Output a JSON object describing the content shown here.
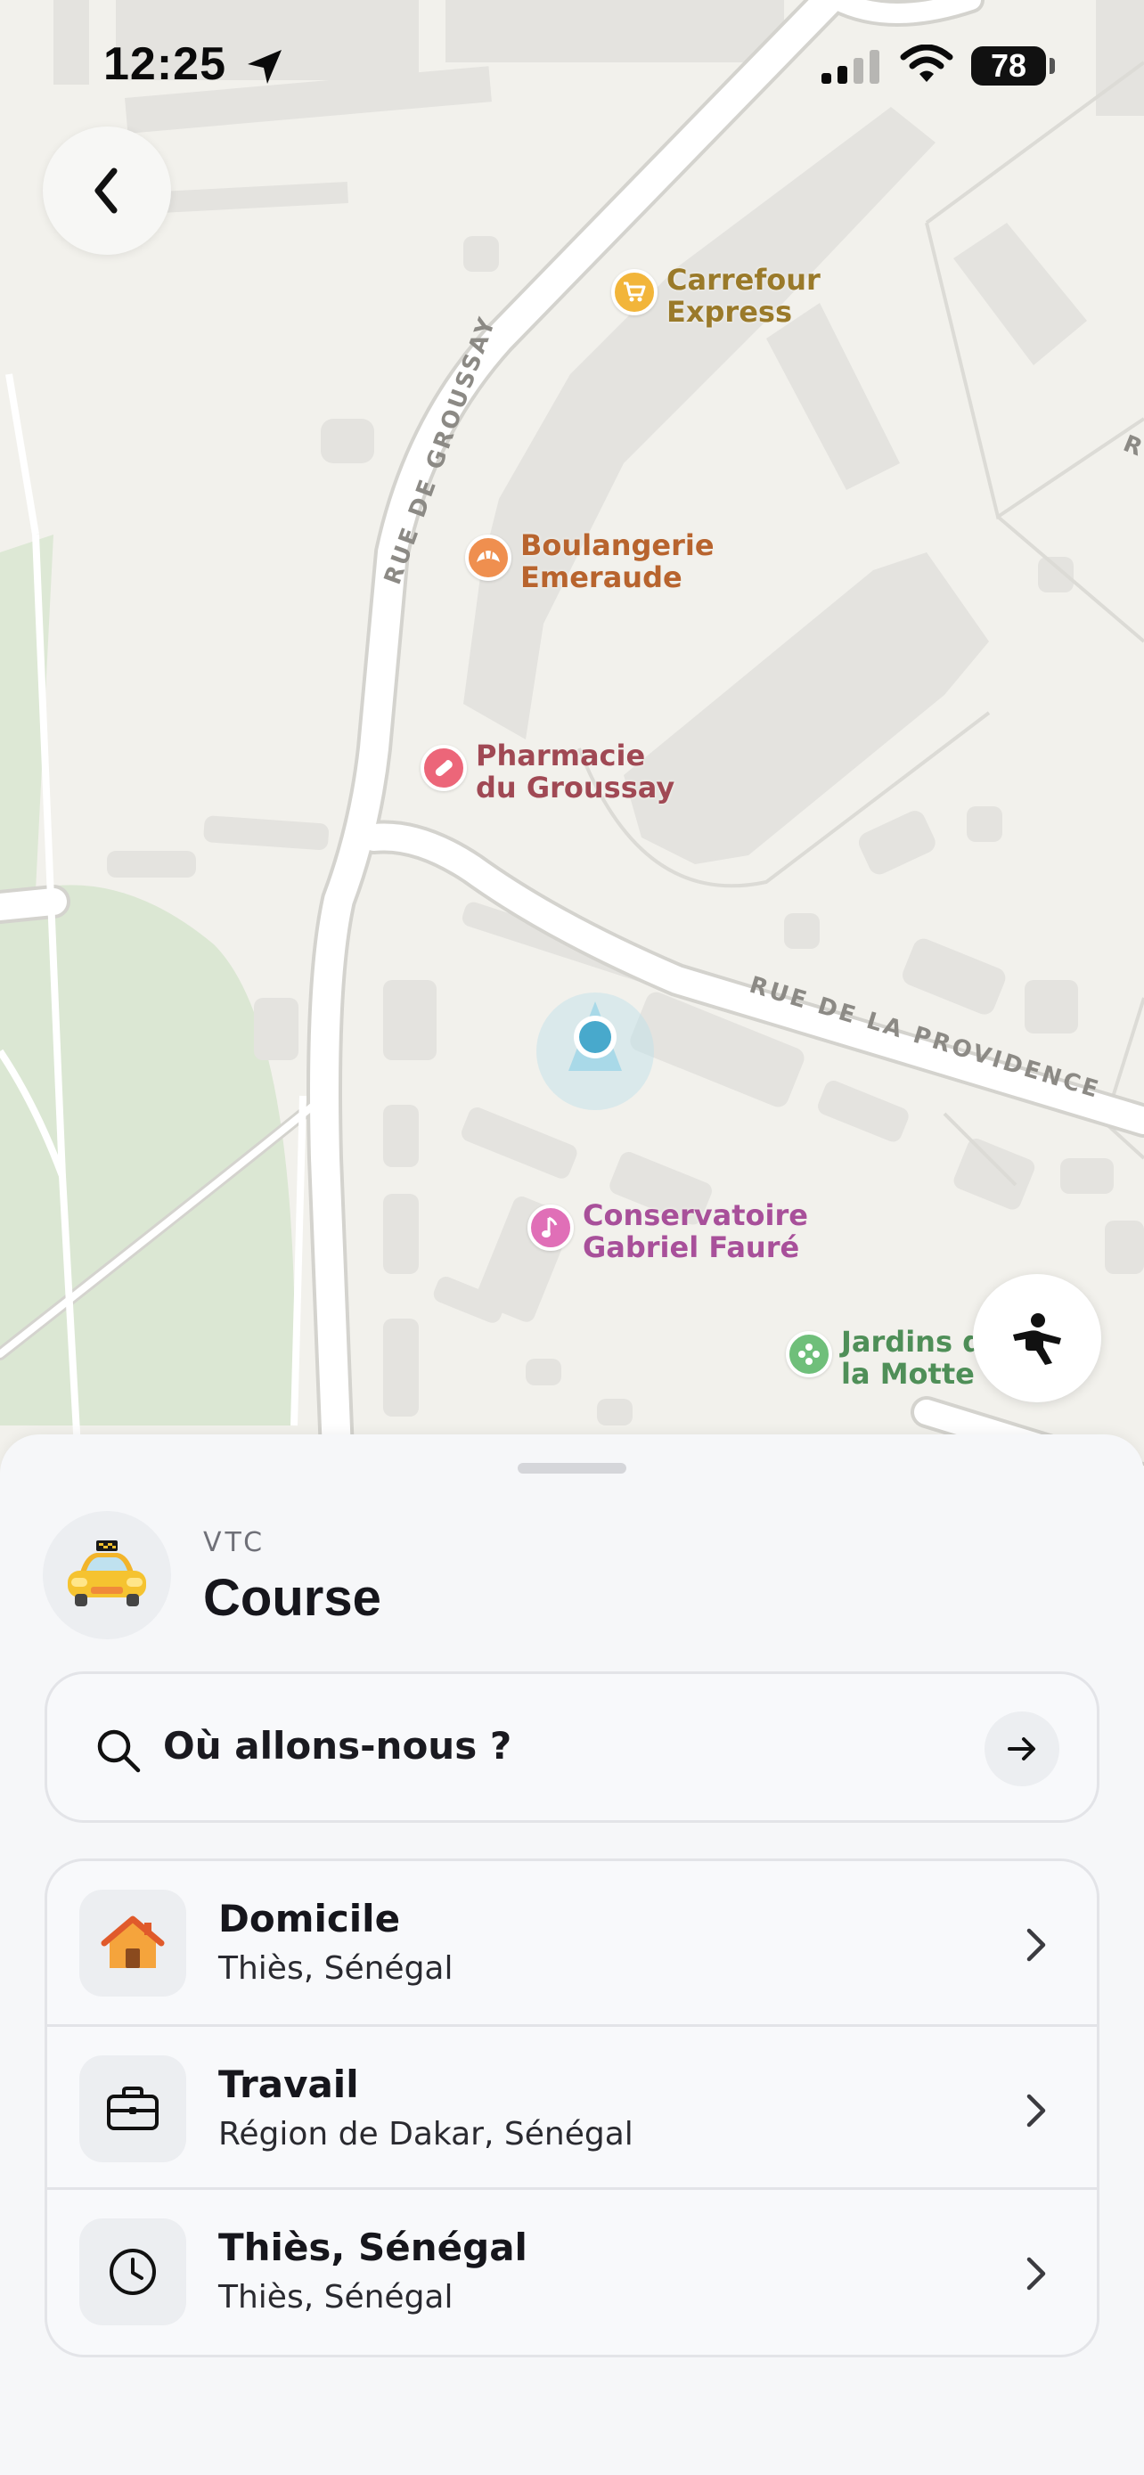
{
  "status_bar": {
    "time": "12:25",
    "battery": "78",
    "icons": [
      "location-arrow-icon",
      "cellular-signal-icon",
      "wifi-icon",
      "battery-icon"
    ]
  },
  "map": {
    "streets": [
      "RUE DE GROUSSAY",
      "RUE DE LA PROVIDENCE",
      "R"
    ],
    "pois": [
      {
        "line1": "Carrefour",
        "line2": "Express",
        "icon": "cart-icon",
        "color": "#f2b53a",
        "text_color": "#9a7a2a"
      },
      {
        "line1": "Boulangerie",
        "line2": "Emeraude",
        "icon": "croissant-icon",
        "color": "#ef8f4f",
        "text_color": "#b8642e"
      },
      {
        "line1": "Pharmacie",
        "line2": "du Groussay",
        "icon": "pill-icon",
        "color": "#ec6679",
        "text_color": "#a04954"
      },
      {
        "line1": "Conservatoire",
        "line2": "Gabriel Fauré",
        "icon": "music-note-icon",
        "color": "#e06fb7",
        "text_color": "#a8509a"
      },
      {
        "line1": "Jardins d",
        "line2": "la Motte",
        "icon": "flower-icon",
        "color": "#6fbf7a",
        "text_color": "#4f8f58"
      }
    ]
  },
  "buttons": {
    "back": "back",
    "accessibility": "accessibility"
  },
  "sheet": {
    "service": {
      "category": "VTC",
      "title": "Course",
      "icon": "taxi-icon"
    },
    "search": {
      "placeholder": "Où allons-nous ?",
      "go_icon": "arrow-right-icon"
    },
    "places": [
      {
        "name": "Domicile",
        "subtitle": "Thiès, Sénégal",
        "icon": "home-icon"
      },
      {
        "name": "Travail",
        "subtitle": "Région de Dakar, Sénégal",
        "icon": "briefcase-icon"
      },
      {
        "name": "Thiès, Sénégal",
        "subtitle": "Thiès, Sénégal",
        "icon": "clock-icon"
      }
    ]
  }
}
